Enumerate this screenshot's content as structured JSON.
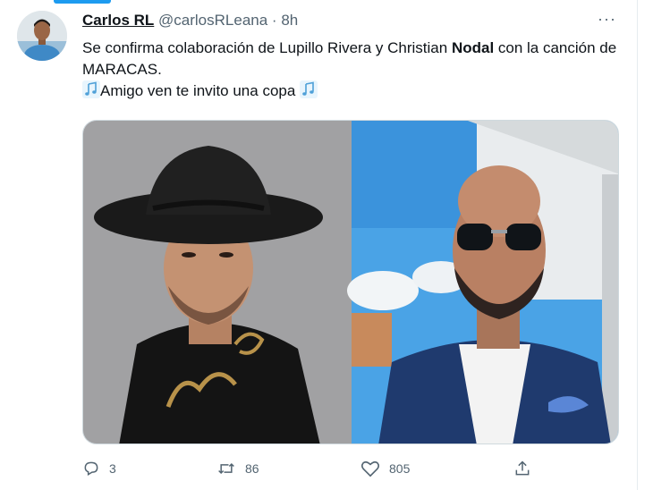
{
  "tweet": {
    "author_name": "Carlos RL",
    "author_handle": "@carlosRLeana",
    "separator": "·",
    "time": "8h",
    "more_label": "···",
    "text_line1_before": "Se confirma colaboración de Lupillo Rivera y Christian ",
    "text_line1_bold": "Nodal",
    "text_line1_after": " con la canción de MARACAS.",
    "text_line2": "Amigo ven te invito una copa",
    "note_icon": "music-notes-icon",
    "media_left_icon": "photo-man-cowboy-hat",
    "media_right_icon": "photo-man-sunglasses"
  },
  "actions": {
    "reply_count": "3",
    "retweet_count": "86",
    "like_count": "805",
    "share_icon": "share-icon"
  },
  "colors": {
    "accent": "#1d9bf0",
    "text": "#0f1419",
    "muted": "#536471"
  }
}
